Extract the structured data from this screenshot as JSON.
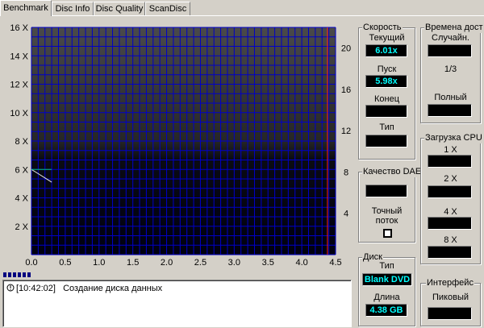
{
  "tabs": [
    "Benchmark",
    "Disc Info",
    "Disc Quality",
    "ScanDisc"
  ],
  "chart_data": {
    "type": "line",
    "title": "",
    "xlabel": "",
    "ylabel": "",
    "xlim": [
      0.0,
      4.5
    ],
    "ylim": [
      0,
      16
    ],
    "y2lim": [
      0,
      22
    ],
    "x_ticks": [
      "0.0",
      "0.5",
      "1.0",
      "1.5",
      "2.0",
      "2.5",
      "3.0",
      "3.5",
      "4.0",
      "4.5"
    ],
    "y_ticks": [
      "2 X",
      "4 X",
      "6 X",
      "8 X",
      "10 X",
      "12 X",
      "14 X",
      "16 X"
    ],
    "y2_ticks": [
      "4",
      "8",
      "12",
      "16",
      "20"
    ],
    "grid": true,
    "marker_x": 4.38,
    "series": [
      {
        "color": "#e8e8e8",
        "x": [
          0.0,
          0.1,
          0.2,
          0.3
        ],
        "y": [
          6.0,
          5.7,
          5.4,
          5.1
        ]
      },
      {
        "color": "#00c080",
        "x": [
          0.0,
          0.1,
          0.2,
          0.3
        ],
        "y": [
          6.0,
          6.0,
          6.0,
          6.0
        ]
      }
    ],
    "colors": {
      "background": "#000000",
      "grid": "#0000c8",
      "marker": "#ff2020",
      "axis_text": "#000000"
    }
  },
  "log": {
    "time": "[10:42:02]",
    "message": "Создание диска данных"
  },
  "speed": {
    "title": "Скорость",
    "current_label": "Текущий",
    "current_value": "6.01x",
    "start_label": "Пуск",
    "start_value": "5.98x",
    "end_label": "Конец",
    "end_value": "",
    "type_label": "Тип",
    "type_value": ""
  },
  "dae": {
    "title": "Качество DAE",
    "value": "",
    "accurate_label_1": "Точный",
    "accurate_label_2": "поток"
  },
  "disc": {
    "title": "Диск",
    "type_label": "Тип",
    "type_value": "Blank DVD",
    "length_label": "Длина",
    "length_value": "4.38 GB"
  },
  "access": {
    "title": "Времена дост",
    "random_label": "Случайн.",
    "random_value": "",
    "third_label": "1/3",
    "third_value": "",
    "full_label": "Полный",
    "full_value": ""
  },
  "cpu": {
    "title": "Загрузка CPU",
    "x1_label": "1 X",
    "x1_value": "",
    "x2_label": "2 X",
    "x2_value": "",
    "x4_label": "4 X",
    "x4_value": "",
    "x8_label": "8 X",
    "x8_value": ""
  },
  "iface": {
    "title": "Интерфейс",
    "burst_label": "Пиковый",
    "burst_value": ""
  }
}
